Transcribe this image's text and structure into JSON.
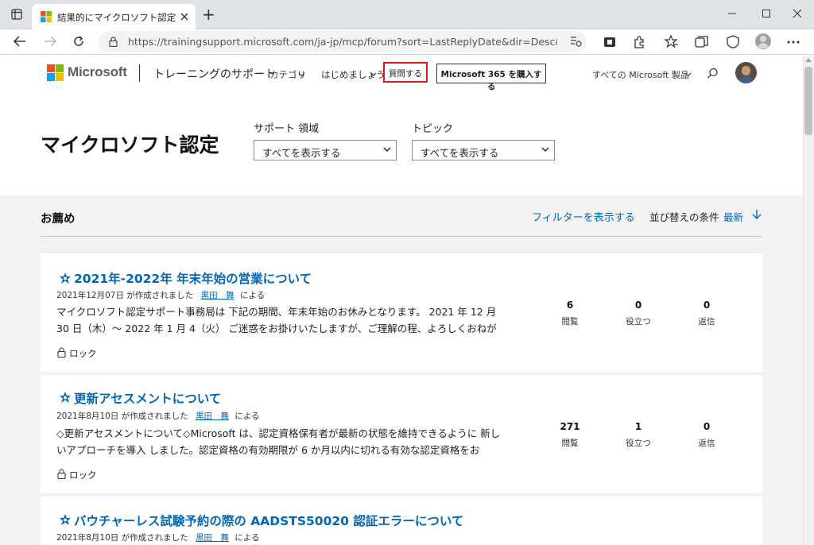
{
  "browser": {
    "tab_title": "結果的にマイクロソフト認定 になる -",
    "new_tab": "+",
    "url": "https://trainingsupport.microsoft.com/ja-jp/mcp/forum?sort=LastReplyDate&dir=Desc&tab=All&sta..."
  },
  "header": {
    "brand": "Microsoft",
    "site_name": "トレーニングのサポート",
    "nav": [
      {
        "label": "カテゴリ"
      },
      {
        "label": "はじめましょう"
      }
    ],
    "ask_label": "質問する",
    "buy_label": "Microsoft 365 を購入する",
    "all_products": "すべての Microsoft 製品"
  },
  "hero": {
    "title": "マイクロソフト認定",
    "support_area_label": "サポート 領域",
    "support_area_value": "すべてを表示する",
    "topic_label": "トピック",
    "topic_value": "すべてを表示する"
  },
  "list": {
    "section_title": "お薦め",
    "filter_link": "フィルターを表示する",
    "sort_label": "並び替えの条件",
    "sort_value": "最新",
    "stat_labels": {
      "views": "閲覧",
      "helpful": "役立つ",
      "replies": "返信"
    },
    "lock_label": "ロック",
    "created_suffix": "が作成されました",
    "by_suffix": "による",
    "threads": [
      {
        "title": "2021年-2022年 年末年始の営業について",
        "date": "2021年12月07日",
        "author": "黒田　舞",
        "body": "マイクロソフト認定サポート事務局は 下記の期間、年末年始のお休みとなります。 2021 年 12 月 30 日（木）～ 2022 年 1 月 4（火） ご迷惑をお掛けいたしますが、ご理解の程、よろしくおねが",
        "views": "6",
        "helpful": "0",
        "replies": "0"
      },
      {
        "title": "更新アセスメントについて",
        "date": "2021年8月10日",
        "author": "黒田　舞",
        "body": "◇更新アセスメントについて◇Microsoft は、認定資格保有者が最新の状態を維持できるように 新しいアプローチを導入 しました。認定資格の有効期限が 6 か月以内に切れる有効な認定資格をお",
        "views": "271",
        "helpful": "1",
        "replies": "0"
      },
      {
        "title": "バウチャーレス試験予約の際の AADSTS50020  認証エラーについて",
        "date": "2021年8月10日",
        "author": "黒田　舞"
      }
    ]
  },
  "colors": {
    "link": "#0067b8",
    "highlight": "#e3151a",
    "content_bg": "#f2f2f2",
    "chrome_bg": "#dfe3e8"
  }
}
